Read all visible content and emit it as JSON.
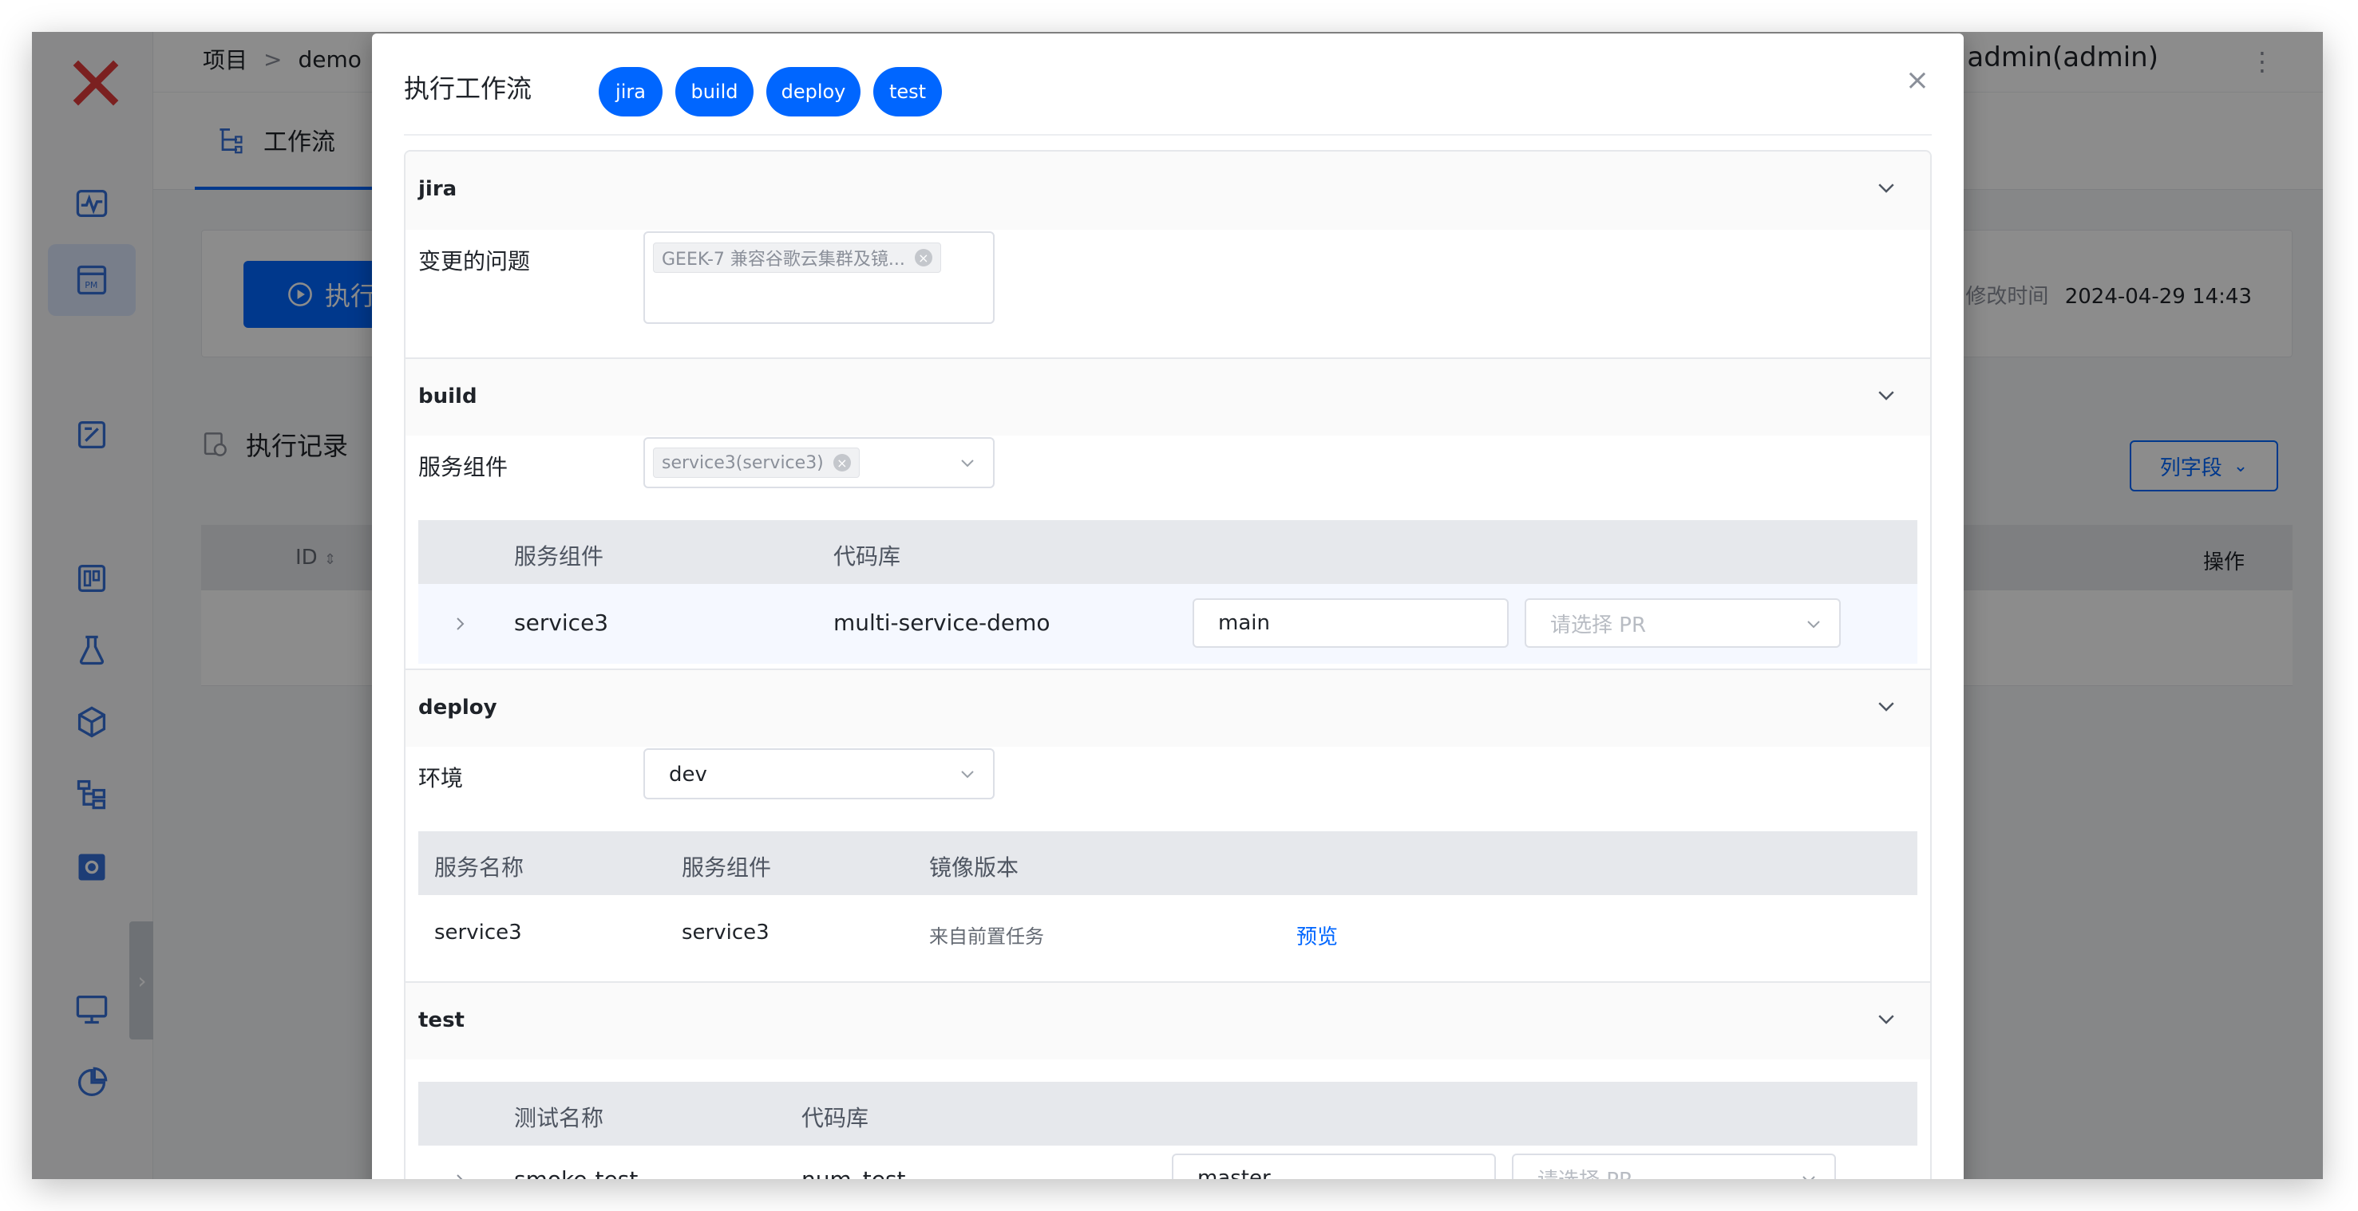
{
  "breadcrumb": {
    "project": "项目",
    "separator": ">",
    "current": "demo"
  },
  "user": {
    "name": "admin(admin)"
  },
  "tabs": {
    "workflow": "工作流"
  },
  "toolbar": {
    "run": "执行",
    "modified_label": "修改时间",
    "modified_value": "2024-04-29 14:43"
  },
  "records": {
    "title": "执行记录",
    "columns_button": "列字段",
    "th_id": "ID",
    "th_operation": "操作"
  },
  "modal": {
    "title": "执行工作流",
    "stages": [
      "jira",
      "build",
      "deploy",
      "test"
    ],
    "close": "×",
    "jira": {
      "title": "jira",
      "field_label": "变更的问题",
      "tag": "GEEK-7 兼容谷歌云集群及镜..."
    },
    "build": {
      "title": "build",
      "field_label": "服务组件",
      "tag": "service3(service3)",
      "columns": [
        "服务组件",
        "代码库"
      ],
      "rows": [
        {
          "service": "service3",
          "repo": "multi-service-demo",
          "branch": "main",
          "pr_placeholder": "请选择 PR"
        }
      ]
    },
    "deploy": {
      "title": "deploy",
      "field_label": "环境",
      "env_value": "dev",
      "columns": [
        "服务名称",
        "服务组件",
        "镜像版本"
      ],
      "rows": [
        {
          "name": "service3",
          "component": "service3",
          "image": "来自前置任务",
          "action": "预览"
        }
      ]
    },
    "test": {
      "title": "test",
      "columns": [
        "测试名称",
        "代码库"
      ],
      "rows": [
        {
          "name": "smoke-test",
          "repo": "num_test",
          "branch": "master",
          "pr_placeholder": "请选择 PR"
        }
      ]
    }
  },
  "colors": {
    "primary": "#0066ff",
    "overlay": "rgba(0,0,0,0.45)"
  },
  "icons": [
    "koderover-logo",
    "monitor-icon",
    "pm-icon",
    "edit-icon",
    "dashboard-icon",
    "flask-icon",
    "box-icon",
    "tree-icon",
    "settings-icon",
    "screen-icon",
    "pie-chart-icon"
  ]
}
